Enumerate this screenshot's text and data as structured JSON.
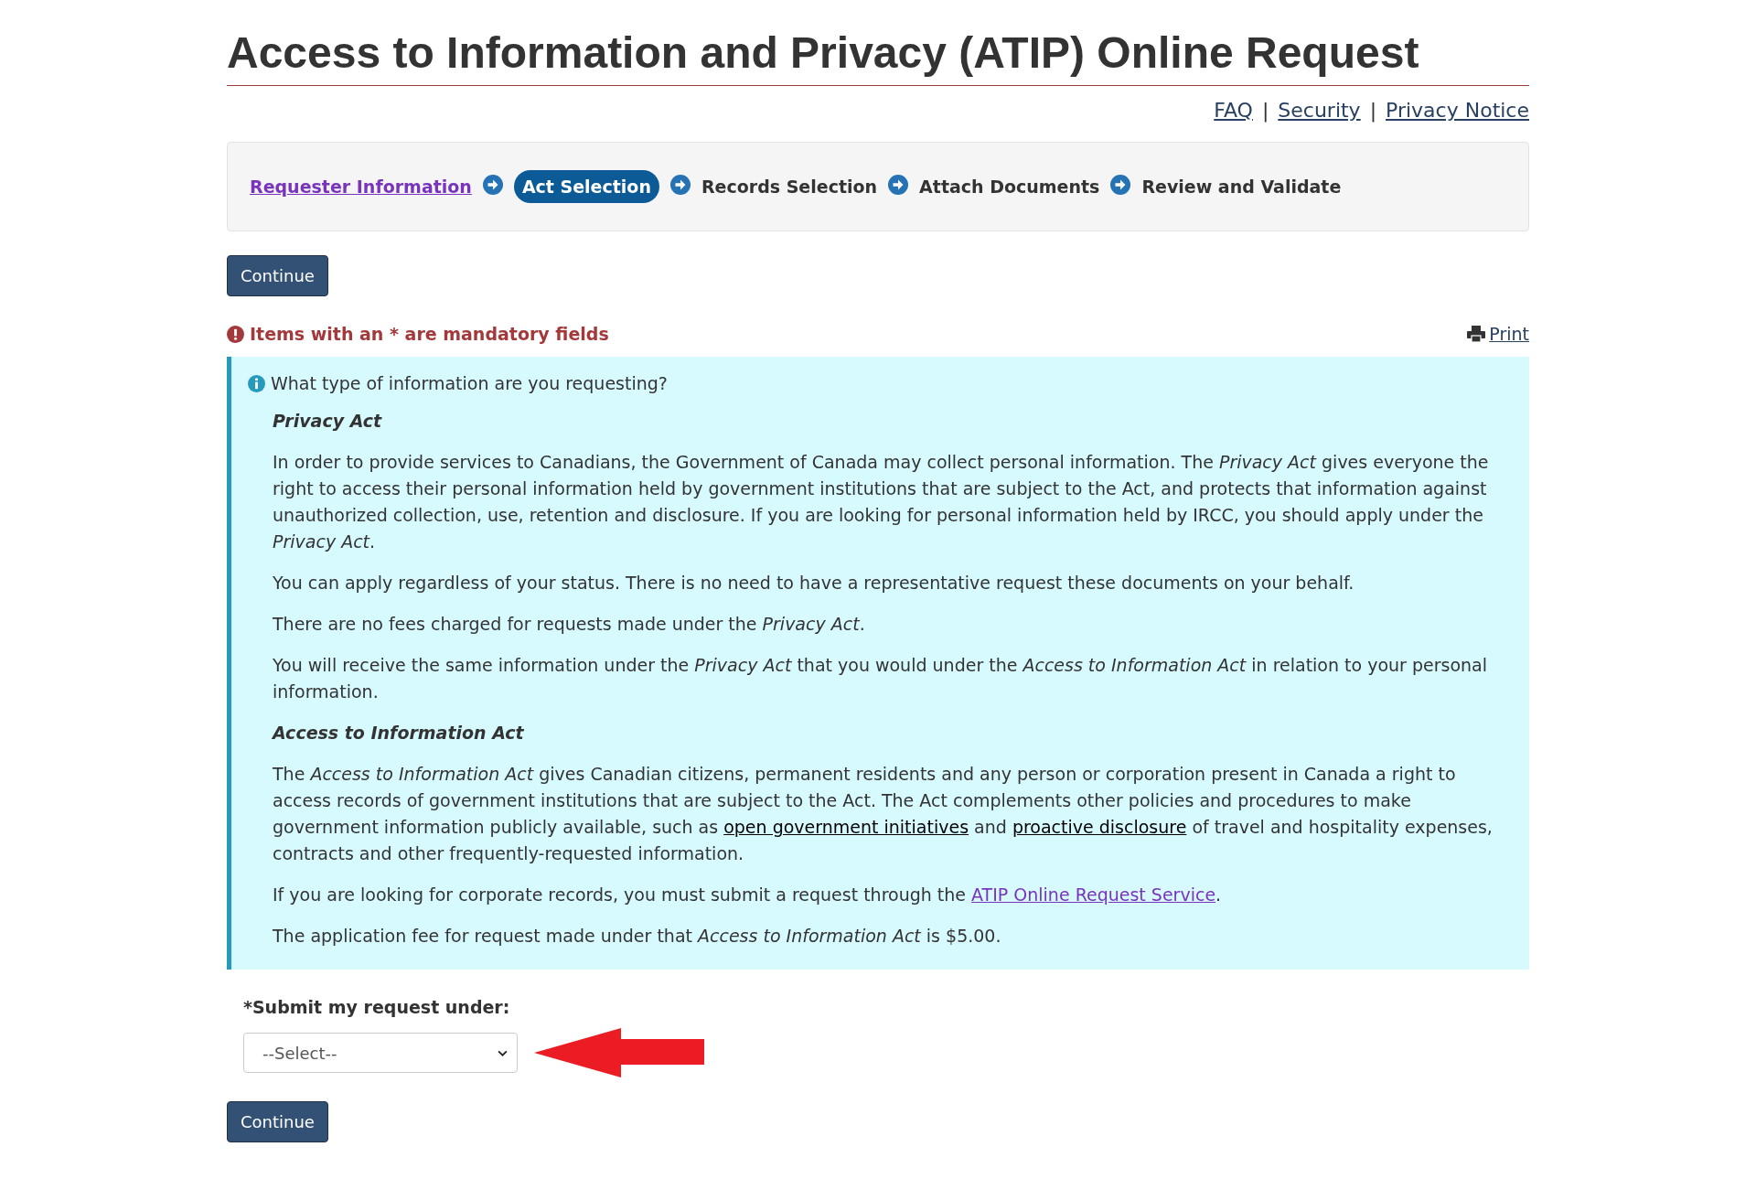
{
  "title": "Access to Information and Privacy (ATIP) Online Request",
  "top_links": [
    "FAQ",
    "Security",
    "Privacy Notice"
  ],
  "link_separator": "|",
  "steps": [
    {
      "label": "Requester Information",
      "selected": false,
      "visited": true
    },
    {
      "label": "Act Selection",
      "selected": true,
      "visited": false
    },
    {
      "label": "Records Selection",
      "selected": false,
      "visited": false
    },
    {
      "label": "Attach Documents",
      "selected": false,
      "visited": false
    },
    {
      "label": "Review and Validate",
      "selected": false,
      "visited": false
    }
  ],
  "continue_top": "Continue",
  "mandatory_note": "Items with an * are mandatory fields",
  "print_link": "Print",
  "info": {
    "question": "What type of information are you requesting?",
    "blocks": [
      {
        "kind": "heading",
        "text": "Privacy Act"
      },
      {
        "kind": "paragraph",
        "parts": [
          {
            "kind": "text",
            "text": "In order to provide services to Canadians, the Government of Canada may collect personal information. The *Privacy Act* gives everyone the right to access their personal information held by government institutions that are subject to the Act, and protects that information against unauthorized collection, use, retention and disclosure. If you are looking for personal information held by IRCC, you should apply under the *Privacy Act*."
          }
        ]
      },
      {
        "kind": "paragraph",
        "parts": [
          {
            "kind": "text",
            "text": "You can apply regardless of your status. There is no need to have a representative request these documents on your behalf."
          }
        ]
      },
      {
        "kind": "paragraph",
        "parts": [
          {
            "kind": "text",
            "text": "There are no fees charged for requests made under the *Privacy Act*."
          }
        ]
      },
      {
        "kind": "paragraph",
        "parts": [
          {
            "kind": "text",
            "text": "You will receive the same information under the *Privacy Act* that you would under the *Access to Information Act* in relation to your personal information."
          }
        ]
      },
      {
        "kind": "heading",
        "text": "Access to Information Act"
      },
      {
        "kind": "paragraph",
        "parts": [
          {
            "kind": "text",
            "text": "The *Access to Information Act* gives Canadian citizens, permanent residents and any person or corporation present in Canada a right to access records of government institutions that are subject to the Act. The Act complements other policies and procedures to make government information publicly available, such as "
          },
          {
            "kind": "link",
            "text": "open government initiatives"
          },
          {
            "kind": "text",
            "text": " and "
          },
          {
            "kind": "link",
            "text": "proactive disclosure"
          },
          {
            "kind": "text",
            "text": " of travel and hospitality expenses, contracts and other frequently-requested information."
          }
        ]
      },
      {
        "kind": "paragraph",
        "parts": [
          {
            "kind": "text",
            "text": "If you are looking for corporate records, you must submit a request through the "
          },
          {
            "kind": "visited_link",
            "text": "ATIP Online Request Service"
          },
          {
            "kind": "text",
            "text": "."
          }
        ]
      },
      {
        "kind": "paragraph",
        "parts": [
          {
            "kind": "text",
            "text": "The application fee for request made under that *Access to Information Act* is $5.00."
          }
        ]
      }
    ]
  },
  "select_label": "*Submit my request under:",
  "select_value": "--Select--",
  "continue_bottom": "Continue"
}
